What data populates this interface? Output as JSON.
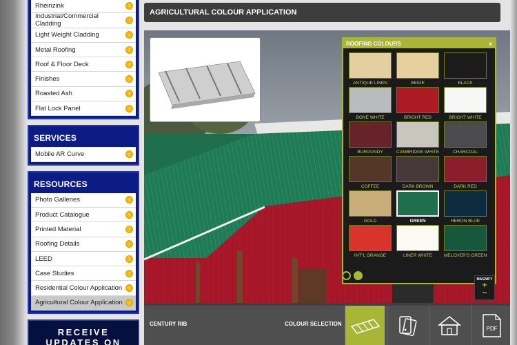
{
  "sidebar": {
    "top_items": [
      "Rheinzink",
      "Industrial/Commercial Cladding",
      "Light Weight Cladding",
      "Metal Roofing",
      "Roof & Floor Deck",
      "Finishes",
      "Roasted Ash",
      "Flat Lock Panel"
    ],
    "services_title": "SERVICES",
    "services_items": [
      "Mobile AR Curve"
    ],
    "resources_title": "RESOURCES",
    "resources_items": [
      "Photo Galleries",
      "Product Catalogue",
      "Printed Material",
      "Roofing Details",
      "LEED",
      "Case Studies",
      "Residential Colour Application",
      "Agricultural Colour Application"
    ],
    "active_item": "Agricultural Colour Application",
    "newsletter_line1": "RECEIVE",
    "newsletter_line2": "UPDATES ON"
  },
  "header": {
    "title": "AGRICULTURAL COLOUR APPLICATION"
  },
  "panel": {
    "title": "ROOFING COLOURS",
    "close_label": "x",
    "selected": "GREEN",
    "colours": [
      {
        "name": "ANTIQUE LINEN",
        "hex": "#e3cfa1"
      },
      {
        "name": "BEIGE",
        "hex": "#e8cfa0"
      },
      {
        "name": "BLACK",
        "hex": "#1d1a1b"
      },
      {
        "name": "BONE WHITE",
        "hex": "#b9bcbc"
      },
      {
        "name": "BRIGHT RED",
        "hex": "#ac1b24"
      },
      {
        "name": "BRIGHT WHITE",
        "hex": "#f7f7f5"
      },
      {
        "name": "BURGUNDY",
        "hex": "#66242a"
      },
      {
        "name": "CAMBRIDGE WHITE",
        "hex": "#c9c6c0"
      },
      {
        "name": "CHARCOAL",
        "hex": "#4b4b4d"
      },
      {
        "name": "COFFEE",
        "hex": "#55372a"
      },
      {
        "name": "DARK BROWN",
        "hex": "#47393a"
      },
      {
        "name": "DARK RED",
        "hex": "#8c1d2b"
      },
      {
        "name": "GOLD",
        "hex": "#c9ae7c"
      },
      {
        "name": "GREEN",
        "hex": "#1f6e4c"
      },
      {
        "name": "HERON BLUE",
        "hex": "#0c2b3f"
      },
      {
        "name": "INT\"L ORANGE",
        "hex": "#d8342b"
      },
      {
        "name": "LINER WHITE",
        "hex": "#fbfaf2"
      },
      {
        "name": "MELCHER'S GREEN",
        "hex": "#17573b"
      }
    ]
  },
  "viewer": {
    "magnify_label": "MAGNIFY",
    "zoom_in": "+",
    "zoom_out": "−"
  },
  "toolbar": {
    "product_label": "CENTURY RIB",
    "colour_label": "COLOUR SELECTION",
    "pdf_label": "PDF"
  }
}
